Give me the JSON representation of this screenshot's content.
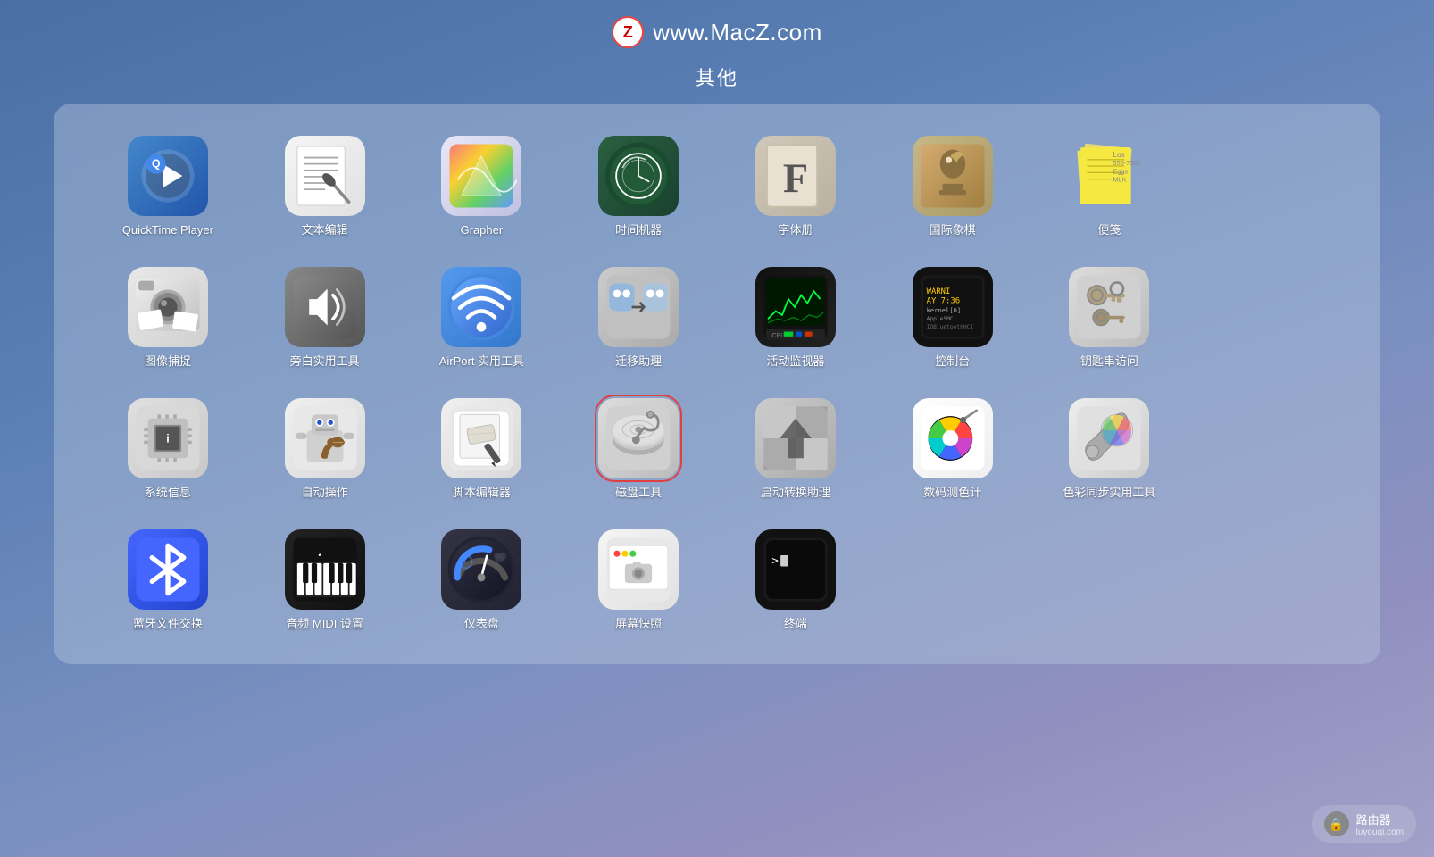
{
  "header": {
    "logo_text": "Z",
    "url": "www.MacZ.com",
    "section_title": "其他"
  },
  "footer": {
    "icon": "🔒",
    "label": "路由器",
    "sublabel": "luyouqi.com"
  },
  "apps": [
    {
      "id": "quicktime",
      "label": "QuickTime Player",
      "icon_class": "icon-quicktime",
      "selected": false
    },
    {
      "id": "textedit",
      "label": "文本编辑",
      "icon_class": "icon-textedit",
      "selected": false
    },
    {
      "id": "grapher",
      "label": "Grapher",
      "icon_class": "icon-grapher",
      "selected": false
    },
    {
      "id": "timemachine",
      "label": "时间机器",
      "icon_class": "icon-timemachine",
      "selected": false
    },
    {
      "id": "fontbook",
      "label": "字体册",
      "icon_class": "icon-fontbook",
      "selected": false
    },
    {
      "id": "chess",
      "label": "国际象棋",
      "icon_class": "icon-chess",
      "selected": false
    },
    {
      "id": "stickies",
      "label": "便笺",
      "icon_class": "icon-stickies",
      "selected": false
    },
    {
      "id": "empty1",
      "label": "",
      "icon_class": "",
      "selected": false
    },
    {
      "id": "imagecapture",
      "label": "图像捕捉",
      "icon_class": "icon-imagecapture",
      "selected": false
    },
    {
      "id": "voiceover",
      "label": "旁白实用工具",
      "icon_class": "icon-voiceover",
      "selected": false
    },
    {
      "id": "airport",
      "label": "AirPort 实用工具",
      "icon_class": "icon-airport",
      "selected": false
    },
    {
      "id": "migration",
      "label": "迁移助理",
      "icon_class": "icon-migration",
      "selected": false
    },
    {
      "id": "activitymonitor",
      "label": "活动监视器",
      "icon_class": "icon-activitymonitor",
      "selected": false
    },
    {
      "id": "console",
      "label": "控制台",
      "icon_class": "icon-console",
      "selected": false
    },
    {
      "id": "keychain",
      "label": "钥匙串访问",
      "icon_class": "icon-keychain",
      "selected": false
    },
    {
      "id": "empty2",
      "label": "",
      "icon_class": "",
      "selected": false
    },
    {
      "id": "sysinfo",
      "label": "系统信息",
      "icon_class": "icon-sysinfo",
      "selected": false
    },
    {
      "id": "automator",
      "label": "自动操作",
      "icon_class": "icon-automator",
      "selected": false
    },
    {
      "id": "scripteditor",
      "label": "脚本编辑器",
      "icon_class": "icon-scripteditor",
      "selected": false
    },
    {
      "id": "diskutility",
      "label": "磁盘工具",
      "icon_class": "icon-diskutility",
      "selected": true
    },
    {
      "id": "bootcamp",
      "label": "启动转换助理",
      "icon_class": "icon-bootcamp",
      "selected": false
    },
    {
      "id": "digitalmeter",
      "label": "数码测色计",
      "icon_class": "icon-digitalmeter",
      "selected": false
    },
    {
      "id": "colorsync",
      "label": "色彩同步实用工具",
      "icon_class": "icon-colorsync",
      "selected": false
    },
    {
      "id": "empty3",
      "label": "",
      "icon_class": "",
      "selected": false
    },
    {
      "id": "bluetooth",
      "label": "蓝牙文件交换",
      "icon_class": "icon-bluetooth",
      "selected": false
    },
    {
      "id": "audiomidi",
      "label": "音频 MIDI 设置",
      "icon_class": "icon-audiomidi",
      "selected": false
    },
    {
      "id": "dashboard",
      "label": "仪表盘",
      "icon_class": "icon-dashboard",
      "selected": false
    },
    {
      "id": "screenshot",
      "label": "屏幕快照",
      "icon_class": "icon-screenshot",
      "selected": false
    },
    {
      "id": "terminal",
      "label": "终端",
      "icon_class": "icon-terminal",
      "selected": false
    },
    {
      "id": "empty4",
      "label": "",
      "icon_class": "",
      "selected": false
    },
    {
      "id": "empty5",
      "label": "",
      "icon_class": "",
      "selected": false
    },
    {
      "id": "empty6",
      "label": "",
      "icon_class": "",
      "selected": false
    }
  ]
}
